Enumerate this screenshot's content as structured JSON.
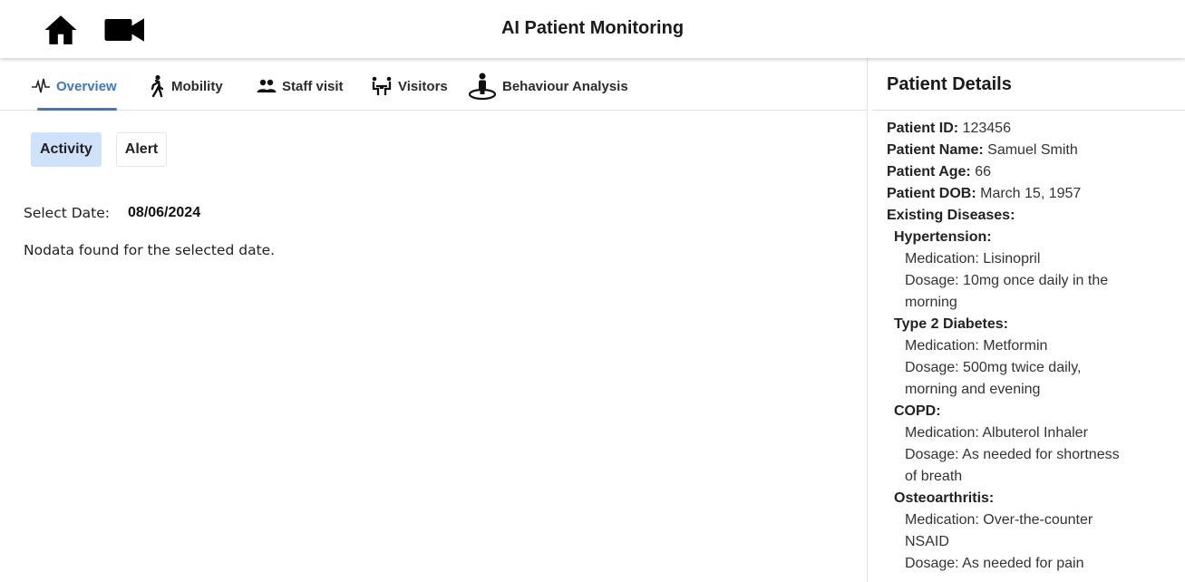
{
  "header": {
    "title": "AI Patient Monitoring",
    "home_icon": "home-icon",
    "video_icon": "video-camera-icon"
  },
  "tabs": [
    {
      "label": "Overview",
      "icon": "heartbeat-icon",
      "active": true
    },
    {
      "label": "Mobility",
      "icon": "walking-icon"
    },
    {
      "label": "Staff visit",
      "icon": "people-icon"
    },
    {
      "label": "Visitors",
      "icon": "visitors-icon"
    },
    {
      "label": "Behaviour Analysis",
      "icon": "person-pin-icon"
    }
  ],
  "subtabs": [
    {
      "label": "Activity",
      "active": true
    },
    {
      "label": "Alert"
    }
  ],
  "date": {
    "label": "Select Date:",
    "value": "08/06/2024"
  },
  "no_data": "Nodata found for the selected date.",
  "patient": {
    "title": "Patient Details",
    "id_label": "Patient ID:",
    "id": "123456",
    "name_label": "Patient Name:",
    "name": "Samuel Smith",
    "age_label": "Patient Age:",
    "age": "66",
    "dob_label": "Patient DOB:",
    "dob": "March 15, 1957",
    "diseases_label": "Existing Diseases:",
    "diseases": [
      {
        "name": "Hypertension:",
        "medication": "Medication: Lisinopril",
        "dosage": "Dosage: 10mg once daily in the morning"
      },
      {
        "name": "Type 2 Diabetes:",
        "medication": "Medication: Metformin",
        "dosage": "Dosage: 500mg twice daily, morning and evening"
      },
      {
        "name": "COPD:",
        "medication": "Medication: Albuterol Inhaler",
        "dosage": "Dosage: As needed for shortness of breath"
      },
      {
        "name": "Osteoarthritis:",
        "medication": "Medication: Over-the-counter NSAID",
        "dosage": "Dosage: As needed for pain"
      }
    ]
  },
  "colors": {
    "accent": "#3a78c9",
    "active_subtab_bg": "#cfe2fb"
  }
}
